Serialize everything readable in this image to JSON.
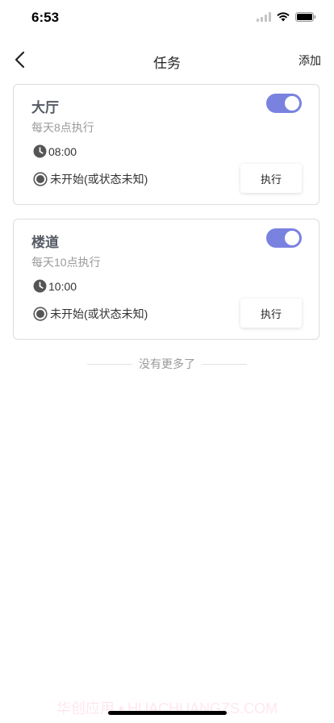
{
  "status_bar": {
    "time": "6:53"
  },
  "nav": {
    "title": "任务",
    "add_label": "添加"
  },
  "tasks": [
    {
      "name": "大厅",
      "schedule": "每天8点执行",
      "time": "08:00",
      "status": "未开始(或状态未知)",
      "enabled": true,
      "execute_label": "执行"
    },
    {
      "name": "楼道",
      "schedule": "每天10点执行",
      "time": "10:00",
      "status": "未开始(或状态未知)",
      "enabled": true,
      "execute_label": "执行"
    }
  ],
  "footer": {
    "no_more": "没有更多了"
  },
  "watermark": "华创应用 • HUACHUANGZS.COM",
  "colors": {
    "accent": "#7a82e0",
    "text_muted": "#9a9a9a",
    "card_border": "#dcdcdc"
  }
}
